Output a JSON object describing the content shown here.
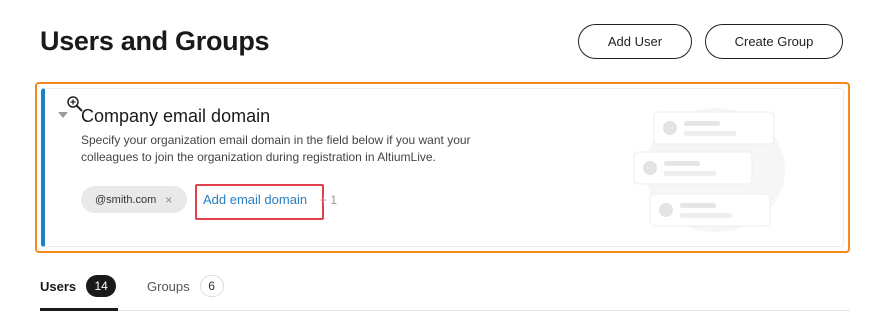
{
  "header": {
    "title": "Users and Groups",
    "add_user_label": "Add User",
    "create_group_label": "Create Group"
  },
  "email_domain_card": {
    "title": "Company email domain",
    "description": "Specify your organization email domain in the field below if you want your colleagues to join the organization during registration in AltiumLive.",
    "domains": [
      "@smith.com"
    ],
    "remove_glyph": "×",
    "add_link_label": "Add email domain",
    "add_count_text": "+ 1"
  },
  "tabs": [
    {
      "label": "Users",
      "count": "14",
      "active": true
    },
    {
      "label": "Groups",
      "count": "6",
      "active": false
    }
  ],
  "colors": {
    "accent_blue": "#1e7fce",
    "link_blue": "#2a7fc1",
    "highlight_orange": "#f08a1c",
    "highlight_red": "#e0404a",
    "text_dark": "#1a1a1a"
  },
  "icons": {
    "zoom": "zoom-in-icon",
    "collapse": "collapse-triangle-icon",
    "remove": "close-icon",
    "illustration": "user-cards-illustration"
  }
}
